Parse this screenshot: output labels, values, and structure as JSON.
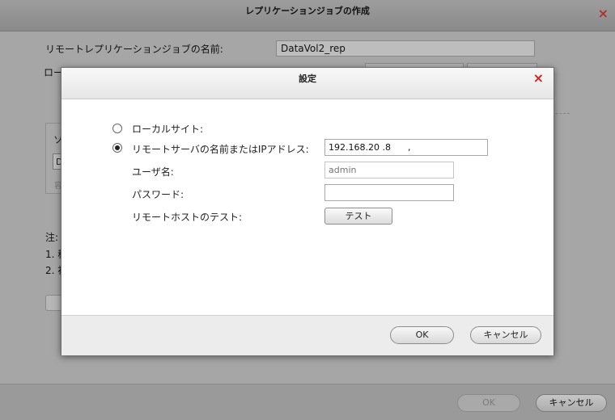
{
  "background_window": {
    "title": "レプリケーションジョブの作成",
    "close_icon": "×",
    "job_name_label": "リモートレプリケーションジョブの名前:",
    "job_name_value": "DataVol2_rep",
    "local_label": "ロー",
    "group_title": "ソ",
    "group_field": "D",
    "group_sub": "容",
    "note_label": "注:",
    "note_1": "1. 移",
    "note_2": "2. 初",
    "ok_label": "OK",
    "cancel_label": "キャンセル"
  },
  "dialog": {
    "title": "設定",
    "close_icon": "×",
    "local_site_label": "ローカルサイト:",
    "remote_server_label": "リモートサーバの名前またはIPアドレス:",
    "remote_server_value": "192.168.20 .8      ,",
    "username_label": "ユーザ名:",
    "username_placeholder": "admin",
    "password_label": "パスワード:",
    "password_value": "",
    "test_label": "リモートホストのテスト:",
    "test_button": "テスト",
    "ok_label": "OK",
    "cancel_label": "キャンセル",
    "selected_option": "remote-server"
  },
  "colors": {
    "close_red": "#d02020",
    "overlay_gray": "#a6a6a6"
  }
}
